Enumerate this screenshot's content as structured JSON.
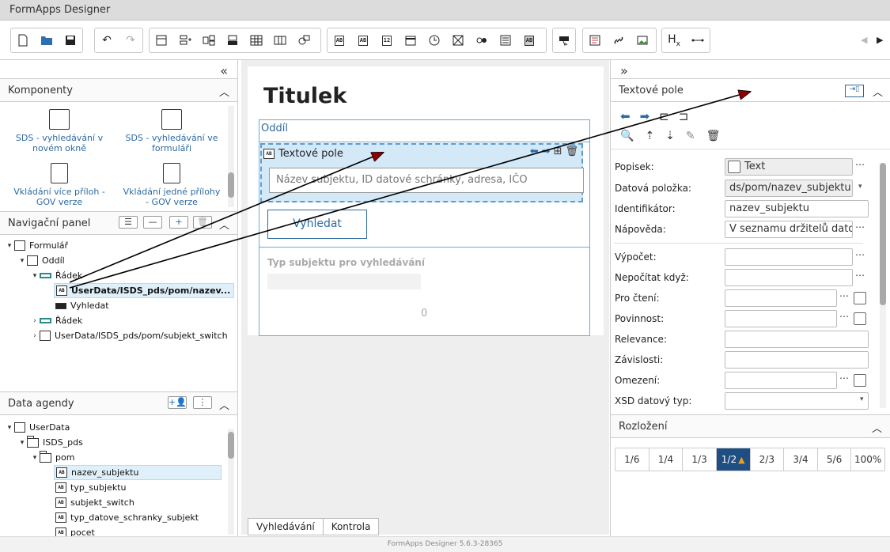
{
  "app": {
    "title": "FormApps Designer",
    "footer": "FormApps Designer 5.6.3-28365"
  },
  "toolbar": {
    "nav_prev": "◀",
    "nav_next": "▶"
  },
  "left": {
    "collapse": "«",
    "komponenty": {
      "title": "Komponenty",
      "items": [
        {
          "label": "SDS - vyhledávání v novém okně"
        },
        {
          "label": "SDS - vyhledávání ve formuláři"
        },
        {
          "label": "Vkládání více příloh - GOV verze"
        },
        {
          "label": "Vkládání jedné přílohy - GOV verze"
        }
      ]
    },
    "nav": {
      "title": "Navigační panel",
      "tree": [
        {
          "label": "Formulář",
          "level": 0,
          "toggle": "▾"
        },
        {
          "label": "Oddíl",
          "level": 1,
          "toggle": "▾"
        },
        {
          "label": "Řádek",
          "level": 2,
          "toggle": "▾"
        },
        {
          "label": "UserData/ISDS_pds/pom/nazev...",
          "level": 3,
          "toggle": ""
        },
        {
          "label": "Vyhledat",
          "level": 3,
          "toggle": ""
        },
        {
          "label": "Řádek",
          "level": 2,
          "toggle": "›"
        },
        {
          "label": "UserData/ISDS_pds/pom/subjekt_switch",
          "level": 2,
          "toggle": "›"
        }
      ]
    },
    "data": {
      "title": "Data agendy",
      "tree": [
        {
          "label": "UserData",
          "level": 0,
          "toggle": "▾"
        },
        {
          "label": "ISDS_pds",
          "level": 1,
          "toggle": "▾"
        },
        {
          "label": "pom",
          "level": 2,
          "toggle": "▾"
        },
        {
          "label": "nazev_subjektu",
          "level": 3,
          "toggle": ""
        },
        {
          "label": "typ_subjektu",
          "level": 3,
          "toggle": ""
        },
        {
          "label": "subjekt_switch",
          "level": 3,
          "toggle": ""
        },
        {
          "label": "typ_datove_schranky_subjekt",
          "level": 3,
          "toggle": ""
        },
        {
          "label": "pocet",
          "level": 3,
          "toggle": ""
        }
      ]
    }
  },
  "canvas": {
    "title": "Titulek",
    "section": "Oddíl",
    "field_label": "Textové pole",
    "field_placeholder": "Název subjektu, ID datové schránky, adresa, IČO",
    "button": "Vyhledat",
    "type_label": "Typ subjektu pro vyhledávání",
    "count": "0",
    "tabs": [
      "Vyhledávání",
      "Kontrola"
    ]
  },
  "right": {
    "expand": "»",
    "title": "Textové pole",
    "rows": [
      {
        "label": "Popisek:",
        "value": "Text"
      },
      {
        "label": "Datová položka:",
        "value": "ds/pom/nazev_subjektu"
      },
      {
        "label": "Identifikátor:",
        "value": "nazev_subjektu"
      },
      {
        "label": "Nápověda:",
        "value": "V seznamu držitelů dato"
      },
      {
        "label": "Výpočet:",
        "value": ""
      },
      {
        "label": "Nepočítat když:",
        "value": ""
      },
      {
        "label": "Pro čtení:",
        "value": ""
      },
      {
        "label": "Povinnost:",
        "value": ""
      },
      {
        "label": "Relevance:",
        "value": ""
      },
      {
        "label": "Závislosti:",
        "value": ""
      },
      {
        "label": "Omezení:",
        "value": ""
      },
      {
        "label": "XSD datový typ:",
        "value": ""
      }
    ],
    "layout_title": "Rozložení",
    "layout_options": [
      "1/6",
      "1/4",
      "1/3",
      "1/2",
      "2/3",
      "3/4",
      "5/6",
      "100%"
    ],
    "layout_selected": "1/2"
  }
}
